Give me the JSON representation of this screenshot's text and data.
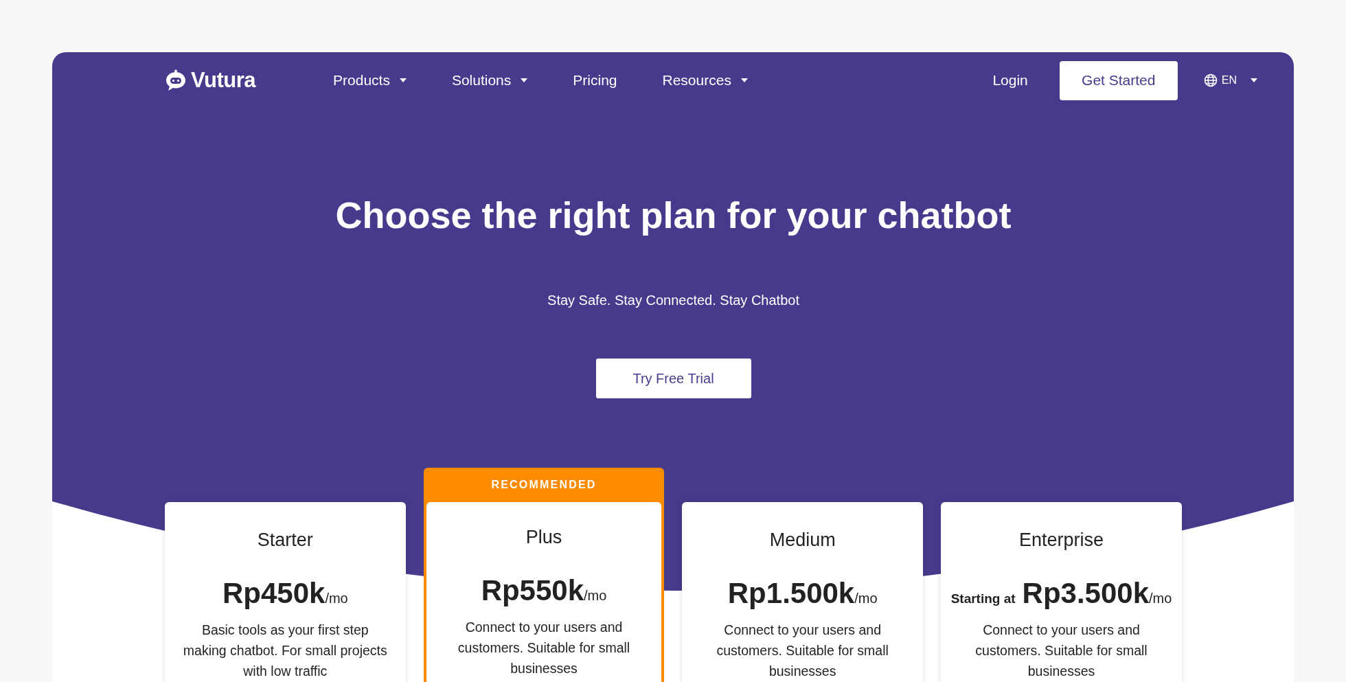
{
  "brand": {
    "name": "Vutura"
  },
  "nav": {
    "items": [
      {
        "label": "Products",
        "has_menu": true
      },
      {
        "label": "Solutions",
        "has_menu": true
      },
      {
        "label": "Pricing",
        "has_menu": false
      },
      {
        "label": "Resources",
        "has_menu": true
      }
    ],
    "login": "Login",
    "cta": "Get Started",
    "language": "EN"
  },
  "hero": {
    "title": "Choose the right plan for your chatbot",
    "subtitle": "Stay Safe. Stay Connected. Stay Chatbot",
    "button": "Try Free Trial"
  },
  "plans": [
    {
      "name": "Starter",
      "price": "Rp450k",
      "period": "/mo",
      "description": "Basic tools as your first step making chatbot. For small projects with low traffic",
      "recommended": false
    },
    {
      "name": "Plus",
      "price": "Rp550k",
      "period": "/mo",
      "description": "Connect to your users and customers. Suitable for small businesses",
      "recommended": true,
      "badge": "RECOMMENDED"
    },
    {
      "name": "Medium",
      "price": "Rp1.500k",
      "period": "/mo",
      "description": "Connect to your users and customers. Suitable for small businesses",
      "recommended": false
    },
    {
      "name": "Enterprise",
      "prefix": "Starting at",
      "price": "Rp3.500k",
      "period": "/mo",
      "description": "Connect to your users and customers. Suitable for small businesses",
      "recommended": false
    }
  ]
}
